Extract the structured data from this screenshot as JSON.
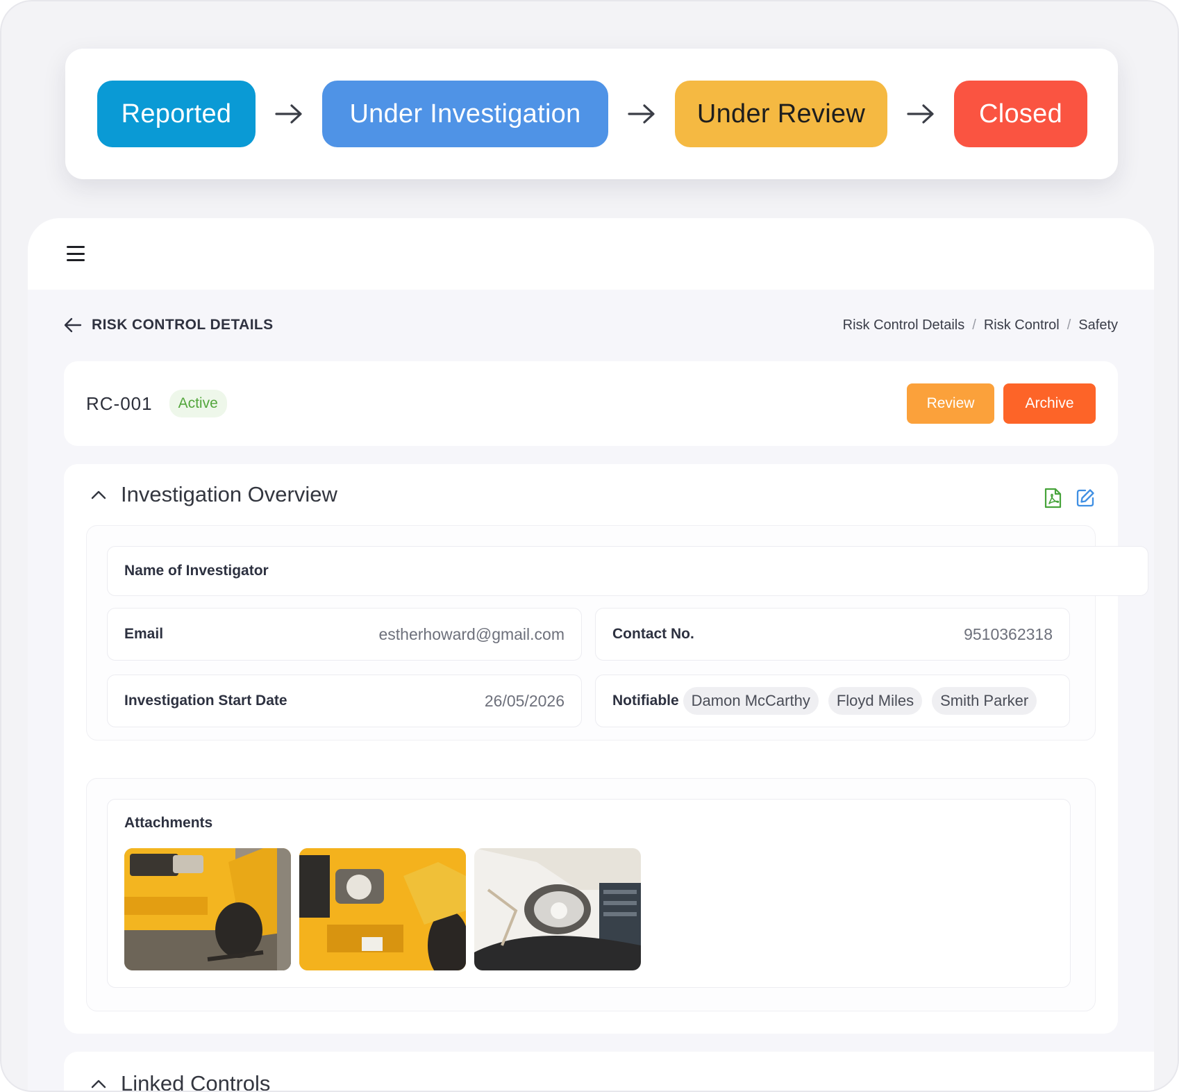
{
  "workflow": {
    "steps": [
      "Reported",
      "Under Investigation",
      "Under Review",
      "Closed"
    ],
    "colors": [
      "#0a9ad5",
      "#4f93e6",
      "#f5b942",
      "#fa5441"
    ]
  },
  "header": {
    "menu_icon": "menu-icon",
    "title": "RISK CONTROL DETAILS",
    "breadcrumb": [
      "Risk Control Details",
      "Risk Control",
      "Safety"
    ]
  },
  "record": {
    "id": "RC-001",
    "status": "Active",
    "review_label": "Review",
    "archive_label": "Archive"
  },
  "overview": {
    "title": "Investigation Overview",
    "icons": [
      "pdf-icon",
      "edit-icon"
    ],
    "investigator_label": "Name of Investigator",
    "email_label": "Email",
    "email_value": "estherhoward@gmail.com",
    "contact_label": "Contact No.",
    "contact_value": "9510362318",
    "start_date_label": "Investigation Start Date",
    "start_date_value": "26/05/2026",
    "notifiable_label": "Notifiable",
    "notifiable": [
      "Damon McCarthy",
      "Floyd Miles",
      "Smith Parker"
    ],
    "attachments_label": "Attachments"
  },
  "linked": {
    "title": "Linked Controls"
  }
}
